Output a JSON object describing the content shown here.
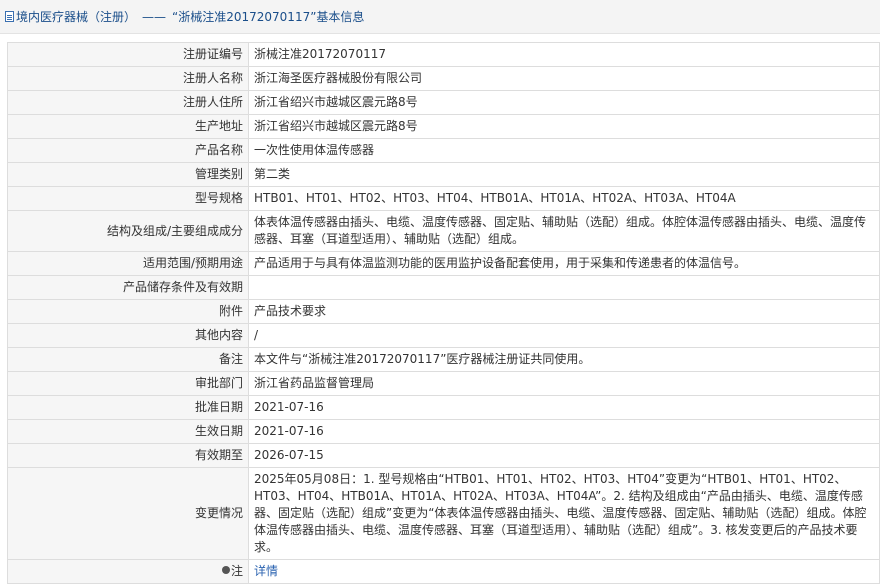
{
  "header": {
    "crumb": "境内医疗器械（注册）",
    "separator": "——",
    "title": "“浙械注准20172070117”基本信息"
  },
  "rows": [
    {
      "label": "注册证编号",
      "value": "浙械注准20172070117"
    },
    {
      "label": "注册人名称",
      "value": "浙江海圣医疗器械股份有限公司"
    },
    {
      "label": "注册人住所",
      "value": "浙江省绍兴市越城区震元路8号"
    },
    {
      "label": "生产地址",
      "value": "浙江省绍兴市越城区震元路8号"
    },
    {
      "label": "产品名称",
      "value": "一次性使用体温传感器"
    },
    {
      "label": "管理类别",
      "value": "第二类"
    },
    {
      "label": "型号规格",
      "value": "HTB01、HT01、HT02、HT03、HT04、HTB01A、HT01A、HT02A、HT03A、HT04A"
    },
    {
      "label": "结构及组成/主要组成成分",
      "value": "体表体温传感器由插头、电缆、温度传感器、固定贴、辅助贴（选配）组成。体腔体温传感器由插头、电缆、温度传感器、耳塞（耳道型适用）、辅助贴（选配）组成。"
    },
    {
      "label": "适用范围/预期用途",
      "value": "产品适用于与具有体温监测功能的医用监护设备配套使用，用于采集和传递患者的体温信号。"
    },
    {
      "label": "产品储存条件及有效期",
      "value": ""
    },
    {
      "label": "附件",
      "value": "产品技术要求"
    },
    {
      "label": "其他内容",
      "value": "/"
    },
    {
      "label": "备注",
      "value": "本文件与“浙械注准20172070117”医疗器械注册证共同使用。"
    },
    {
      "label": "审批部门",
      "value": "浙江省药品监督管理局"
    },
    {
      "label": "批准日期",
      "value": "2021-07-16"
    },
    {
      "label": "生效日期",
      "value": "2021-07-16"
    },
    {
      "label": "有效期至",
      "value": "2026-07-15"
    },
    {
      "label": "变更情况",
      "value": "2025年05月08日：1. 型号规格由“HTB01、HT01、HT02、HT03、HT04”变更为“HTB01、HT01、HT02、HT03、HT04、HTB01A、HT01A、HT02A、HT03A、HT04A”。2. 结构及组成由“产品由插头、电缆、温度传感器、固定贴（选配）组成”变更为“体表体温传感器由插头、电缆、温度传感器、固定贴、辅助贴（选配）组成。体腔体温传感器由插头、电缆、温度传感器、耳塞（耳道型适用）、辅助贴（选配）组成”。3. 核发变更后的产品技术要求。"
    }
  ],
  "note_row": {
    "label": "注",
    "icon": "pin-icon",
    "link_text": "详情"
  },
  "colors": {
    "link": "#2a62b0",
    "header_text": "#1a4e8a",
    "label_bg": "#f6f6f6",
    "border": "#dddddd"
  }
}
